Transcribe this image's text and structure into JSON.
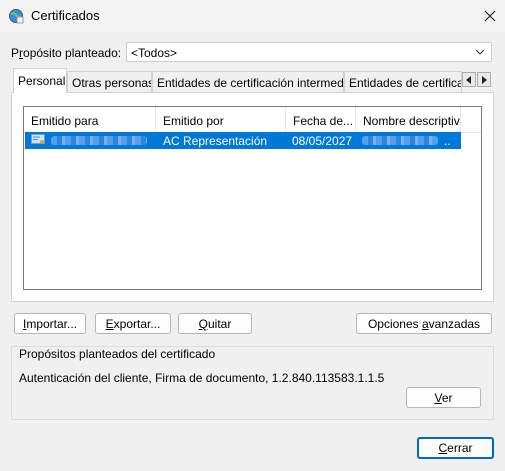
{
  "window": {
    "title": "Certificados",
    "close_glyph": "✕",
    "icon": "certificate-globe-icon"
  },
  "purpose": {
    "label_prefix": "P",
    "label_underlined": "r",
    "label_rest": "opósito planteado:",
    "value": "<Todos>"
  },
  "tabs": [
    {
      "label": "Personal"
    },
    {
      "label": "Otras personas"
    },
    {
      "label": "Entidades de certificación intermedias"
    },
    {
      "label": "Entidades de certificaci"
    }
  ],
  "table": {
    "columns": [
      "Emitido para",
      "Emitido por",
      "Fecha de...",
      "Nombre descriptivo"
    ],
    "rows": [
      {
        "issued_by": "AC Representación",
        "expires": "08/05/2027",
        "friendly_suffix": ".."
      }
    ]
  },
  "buttons": {
    "import": {
      "pre": "",
      "u": "I",
      "post": "mportar..."
    },
    "export": {
      "pre": "",
      "u": "E",
      "post": "xportar..."
    },
    "remove": {
      "pre": "",
      "u": "Q",
      "post": "uitar"
    },
    "advanced": {
      "pre": "Opciones ",
      "u": "a",
      "post": "vanzadas"
    },
    "view": {
      "pre": "",
      "u": "V",
      "post": "er"
    },
    "close": {
      "pre": "",
      "u": "C",
      "post": "errar"
    }
  },
  "purposes_group": {
    "title": "Propósitos planteados del certificado",
    "text": "Autenticación del cliente, Firma de documento, 1.2.840.113583.1.1.5"
  },
  "colors": {
    "selection": "#0078d7",
    "default_button_border": "#0067c0"
  }
}
